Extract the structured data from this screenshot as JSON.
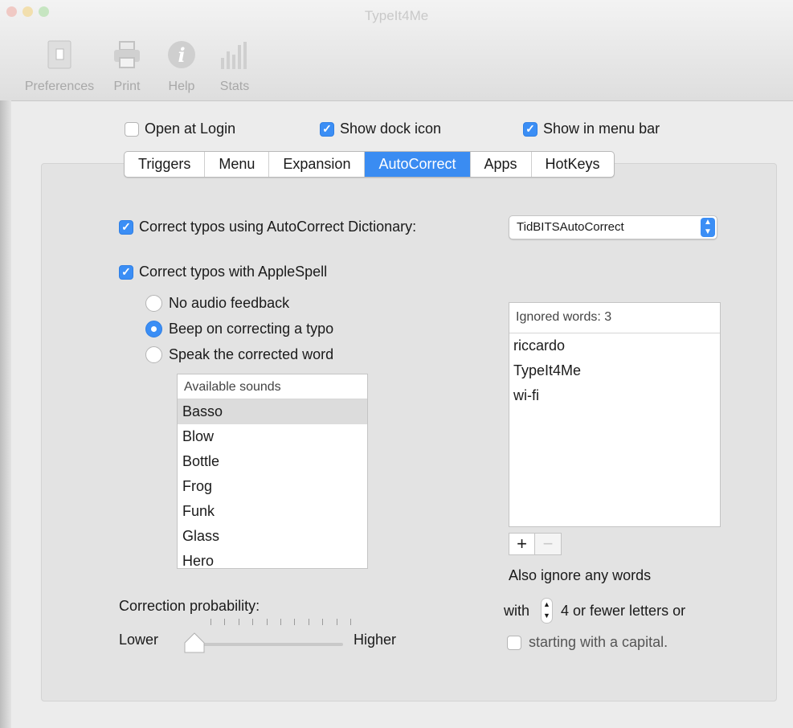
{
  "window": {
    "title": "TypeIt4Me",
    "toolbar": [
      {
        "label": "Preferences",
        "icon": "preferences-icon"
      },
      {
        "label": "Print",
        "icon": "printer-icon"
      },
      {
        "label": "Help",
        "icon": "info-icon"
      },
      {
        "label": "Stats",
        "icon": "bar-chart-icon"
      }
    ]
  },
  "general": {
    "open_at_login": {
      "label": "Open at Login",
      "checked": false
    },
    "show_dock_icon": {
      "label": "Show dock icon",
      "checked": true
    },
    "show_in_menu_bar": {
      "label": "Show in menu bar",
      "checked": true
    }
  },
  "tabs": [
    "Triggers",
    "Menu",
    "Expansion",
    "AutoCorrect",
    "Apps",
    "HotKeys"
  ],
  "selected_tab": "AutoCorrect",
  "autocorrect": {
    "dictionary_label": "Correct typos using AutoCorrect Dictionary:",
    "dictionary_checked": true,
    "dictionary_value": "TidBITSAutoCorrect",
    "applespell_label": "Correct typos with AppleSpell",
    "applespell_checked": true,
    "feedback": [
      {
        "label": "No audio feedback",
        "selected": false
      },
      {
        "label": "Beep on correcting a typo",
        "selected": true
      },
      {
        "label": "Speak the corrected word",
        "selected": false
      }
    ],
    "sounds_header": "Available sounds",
    "sounds": [
      "Basso",
      "Blow",
      "Bottle",
      "Frog",
      "Funk",
      "Glass",
      "Hero"
    ],
    "selected_sound": "Basso",
    "ignored_header": "Ignored words: 3",
    "ignored_words": [
      "riccardo",
      "TypeIt4Me",
      "wi-fi"
    ],
    "add_symbol": "+",
    "remove_symbol": "−",
    "also_ignore": "Also ignore any words",
    "with_label": "with",
    "letters_label": "4 or fewer letters or",
    "capital_label": "starting with a capital.",
    "capital_checked": false,
    "probability_label": "Correction probability:",
    "lower_label": "Lower",
    "higher_label": "Higher",
    "probability_level": 0.0
  },
  "colors": {
    "accent": "#3b8ef5"
  }
}
